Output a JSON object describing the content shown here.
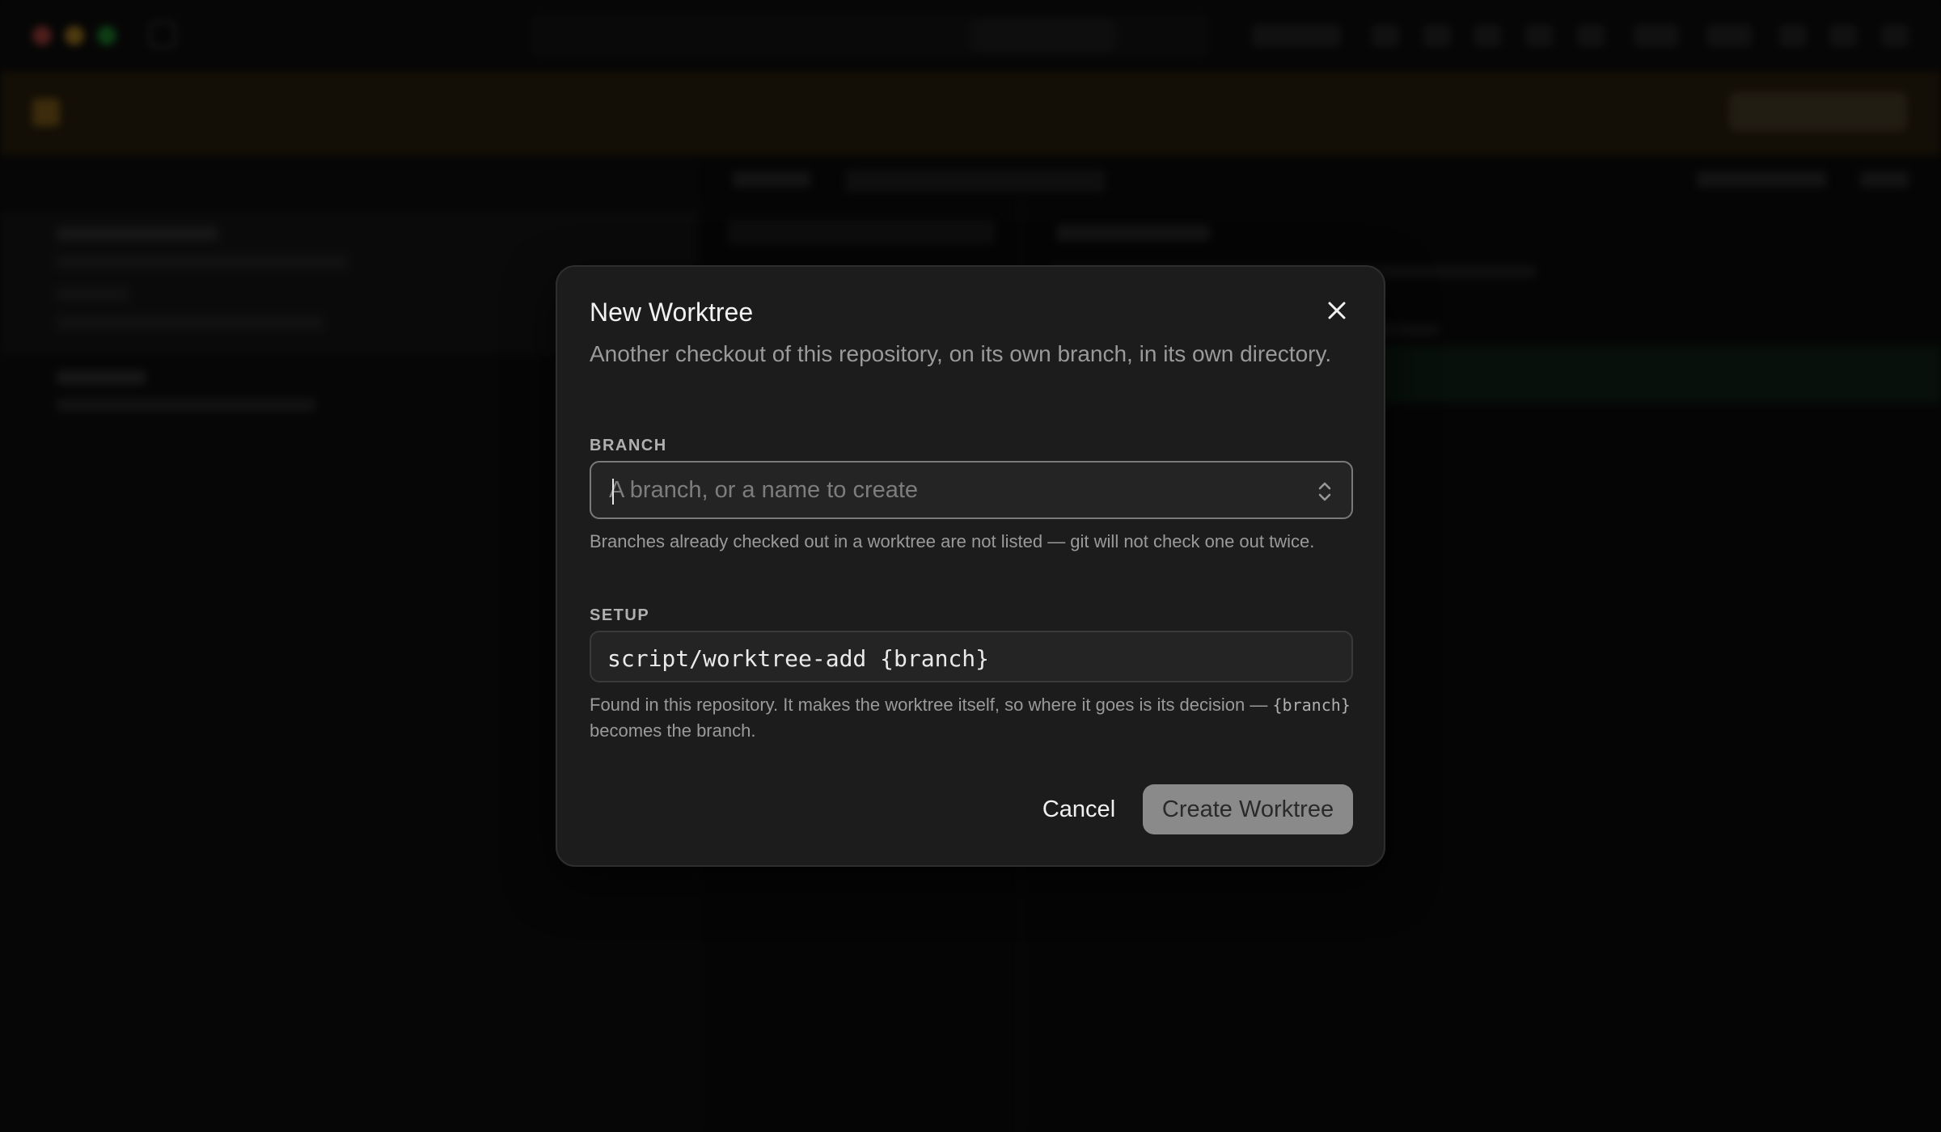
{
  "dialog": {
    "title": "New Worktree",
    "description": "Another checkout of this repository, on its own branch, in its own directory.",
    "branch": {
      "label": "BRANCH",
      "placeholder": "A branch, or a name to create",
      "value": "",
      "hint": "Branches already checked out in a worktree are not listed — git will not check one out twice."
    },
    "setup": {
      "label": "SETUP",
      "value": "script/worktree-add {branch}",
      "hint_before": "Found in this repository. It makes the worktree itself, so where it goes is its decision —",
      "hint_code": "{branch}",
      "hint_after": "becomes the branch."
    },
    "cancel_label": "Cancel",
    "create_label": "Create Worktree"
  },
  "colors": {
    "banner": "#3a2a0c",
    "accent_disabled": "#8a8a8a",
    "dialog_bg": "#1c1c1c"
  },
  "icons": {
    "close": "close-icon",
    "stepper": "chevron-up-down-icon"
  }
}
